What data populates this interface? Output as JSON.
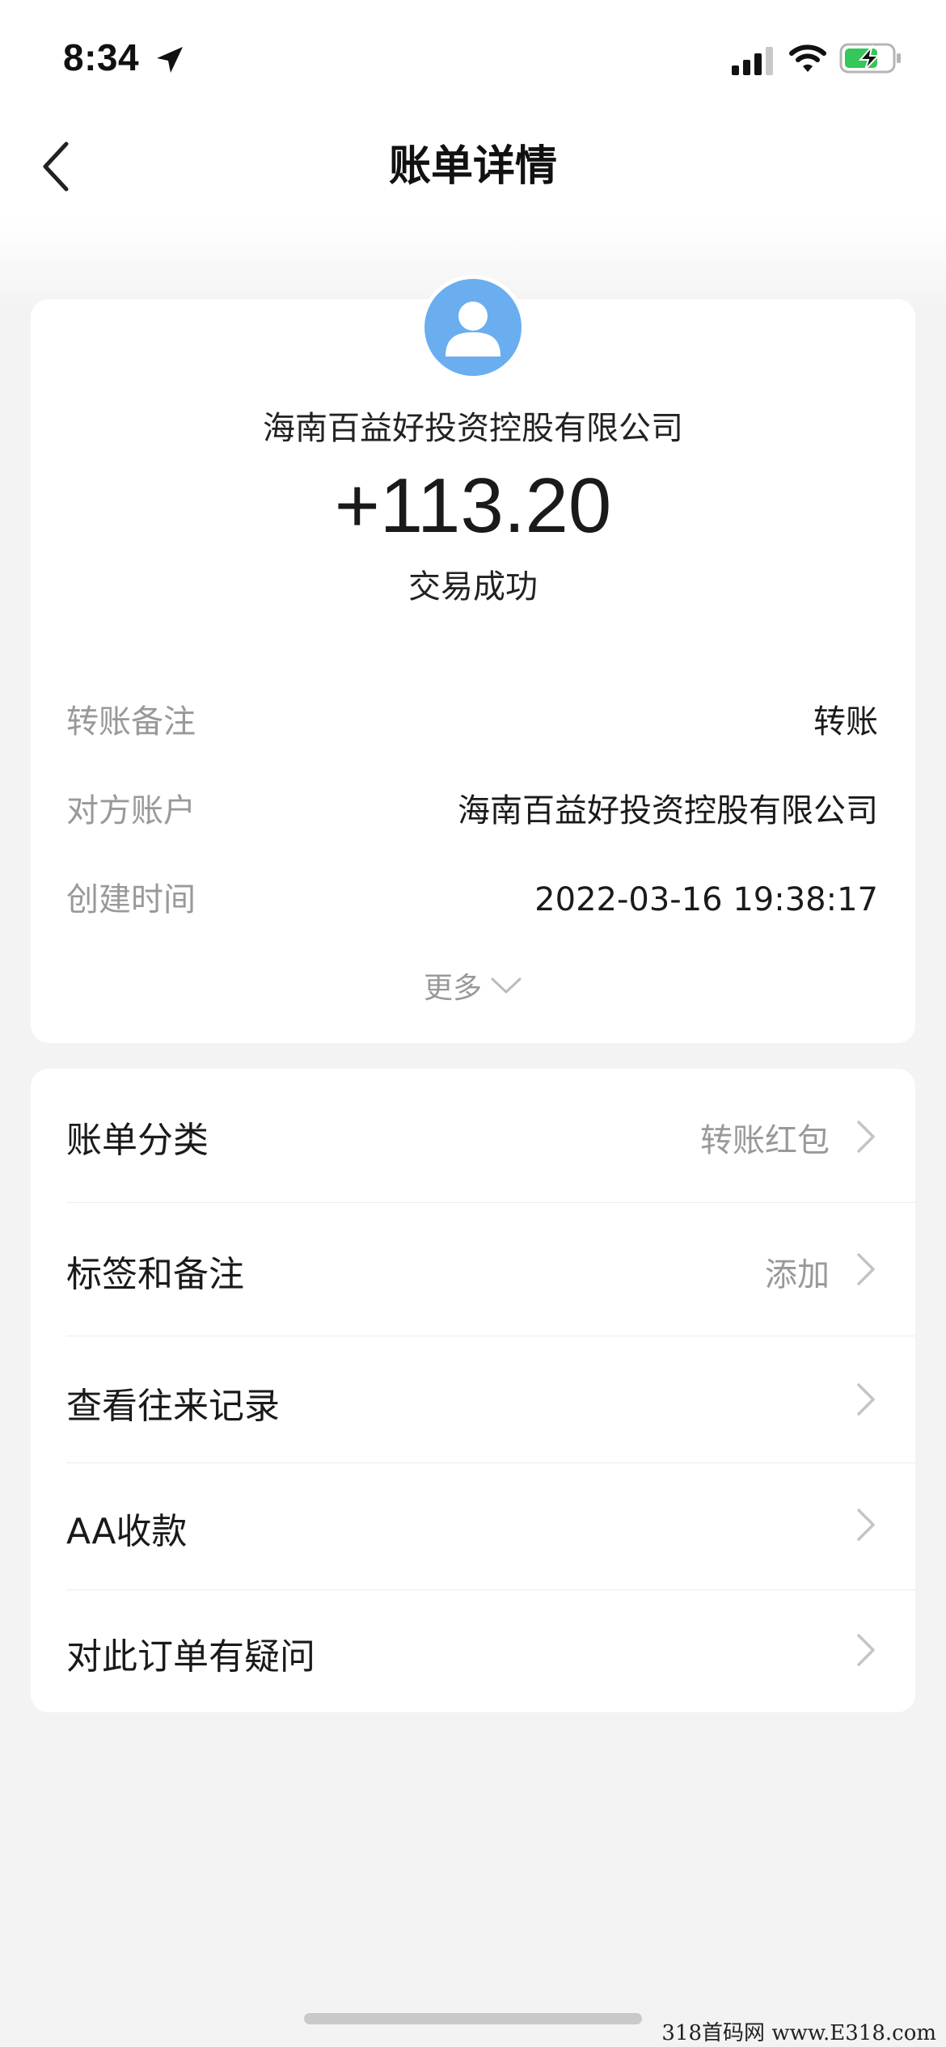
{
  "status_bar": {
    "time": "8:34"
  },
  "nav": {
    "title": "账单详情"
  },
  "summary": {
    "payee": "海南百益好投资控股有限公司",
    "amount": "+113.20",
    "status": "交易成功"
  },
  "details": [
    {
      "label": "转账备注",
      "value": "转账"
    },
    {
      "label": "对方账户",
      "value": "海南百益好投资控股有限公司"
    },
    {
      "label": "创建时间",
      "value": "2022-03-16 19:38:17"
    }
  ],
  "more_label": "更多",
  "menu": [
    {
      "label": "账单分类",
      "value": "转账红包"
    },
    {
      "label": "标签和备注",
      "value": "添加"
    },
    {
      "label": "查看往来记录",
      "value": ""
    },
    {
      "label": "AA收款",
      "value": ""
    },
    {
      "label": "对此订单有疑问",
      "value": ""
    }
  ],
  "watermark": "318首码网  www.E318.com",
  "colors": {
    "avatar": "#6aaef0",
    "label_gray": "#999999",
    "background": "#f3f3f3"
  }
}
